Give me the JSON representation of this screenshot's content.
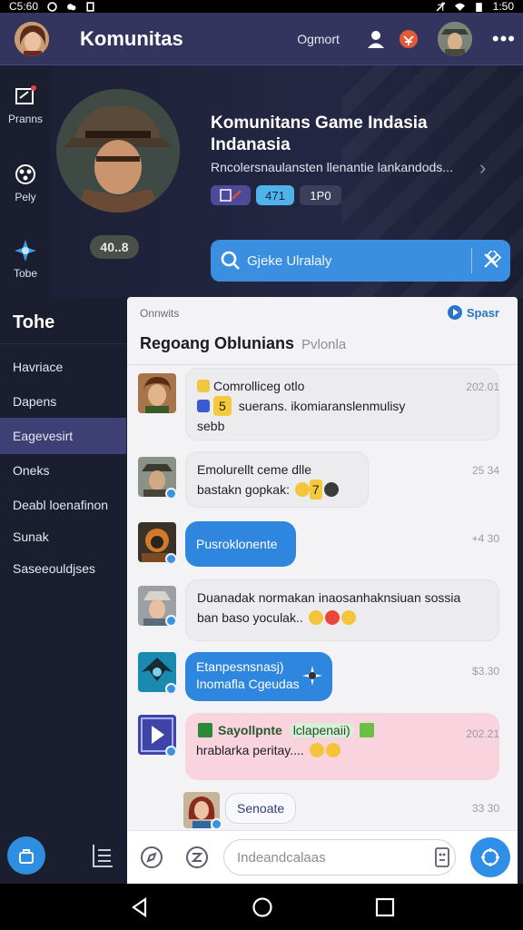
{
  "status_bar": {
    "time_left": "C5:60",
    "time_right": "1:50"
  },
  "app_bar": {
    "title": "Komunitas",
    "link": "Ogmort"
  },
  "rail": [
    {
      "label": "Pranns",
      "icon": "edit-icon"
    },
    {
      "label": "Pely",
      "icon": "play-icon"
    },
    {
      "label": "Tobe",
      "icon": "spark-icon"
    }
  ],
  "hero": {
    "badge": "40..8",
    "title": "Komunitans Game Indasia Indanasia",
    "description": "Rncolersnaulansten llenantie lankandods...",
    "chip_count": "471",
    "chip_label": "1P0",
    "search_placeholder": "Gjeke Ulralaly"
  },
  "left_nav": {
    "title": "Tohe",
    "items": [
      {
        "label": "Havriace",
        "active": false
      },
      {
        "label": "Dapens",
        "active": false
      },
      {
        "label": "Eagevesirt",
        "active": true
      },
      {
        "label": "Oneks",
        "active": false
      },
      {
        "label": "Deabl loenafinon",
        "active": false
      },
      {
        "label": "Sunak",
        "active": false
      },
      {
        "label": "Saseeouldjses",
        "active": false
      }
    ]
  },
  "panel": {
    "subtitle": "Onnwits",
    "action": "Spasr",
    "title": "Regoang Oblunians",
    "title_sub": "Pvlonla"
  },
  "messages": [
    {
      "line1": "Comrolliceg otlo",
      "num": "5",
      "line2": "suerans. ikomiaranslenmulisy",
      "line3": "sebb",
      "time": "202.01"
    },
    {
      "line1": "Emolurellt ceme dlle",
      "line2": "bastakn gopkak:",
      "num": "7",
      "time": "25 34"
    },
    {
      "line1": "Pusroklonente",
      "time": "+4 30"
    },
    {
      "line1": "Duanadak normakan inaosanhaknsiuan sossia",
      "line2": "ban baso yoculak..",
      "time": ""
    },
    {
      "line1": "Etanpesnsnasj)",
      "line2": "Inomafla Cgeudas",
      "time": "$3.30"
    },
    {
      "line1": "Sayollpnte",
      "line1b": "lclapenaii)",
      "line2": "hrablarka peritay....",
      "time": "202.21"
    },
    {
      "line1": "Senoate",
      "time": "33 30"
    }
  ],
  "input": {
    "placeholder": "Indeandcalaas"
  },
  "colors": {
    "app_bar": "#33355e",
    "accent": "#2f86df",
    "nav_active": "#3e3f74",
    "panel": "#f3f3f5",
    "pink_bubble": "#f9d3dd"
  }
}
